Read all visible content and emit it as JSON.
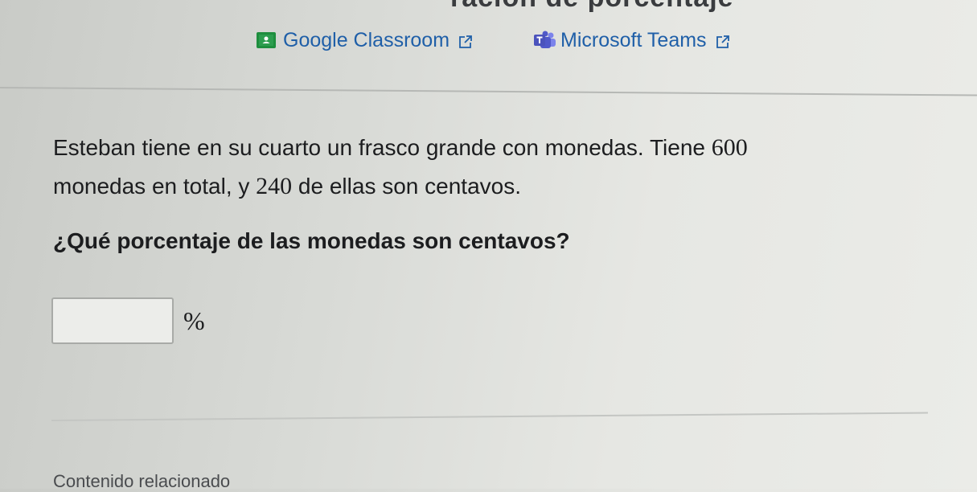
{
  "header": {
    "title_fragment": "ración de porcentaje"
  },
  "share": {
    "google": {
      "label": "Google Classroom",
      "icon": "google-classroom-icon",
      "brand_color": "#1e8e3e"
    },
    "teams": {
      "label": "Microsoft Teams",
      "icon": "microsoft-teams-icon",
      "brand_color": "#4b53bc"
    },
    "external_icon": "external-link-icon",
    "link_color": "#1f5fa8"
  },
  "problem": {
    "text_1": "Esteban tiene en su cuarto un frasco grande con monedas. Tiene ",
    "total": "600",
    "text_2": "monedas en total, y ",
    "cents": "240",
    "text_3": " de ellas son centavos."
  },
  "question": {
    "text": "¿Qué porcentaje de las monedas son centavos?"
  },
  "answer": {
    "value": "",
    "placeholder": "",
    "unit": "%"
  },
  "footer": {
    "related_label": "Contenido relacionado"
  }
}
